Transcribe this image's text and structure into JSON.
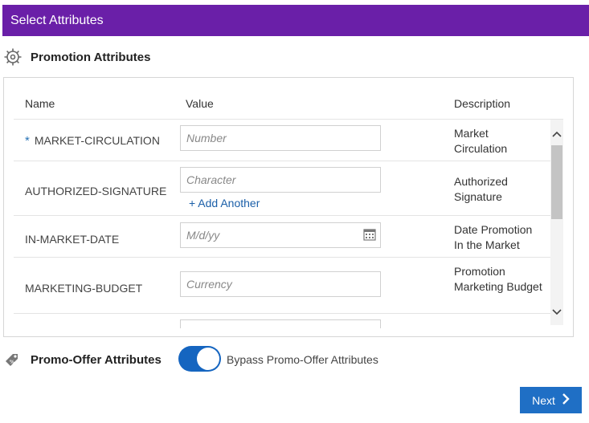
{
  "header": {
    "title": "Select Attributes"
  },
  "promotion_section": {
    "title": "Promotion Attributes",
    "icon": "gear-icon"
  },
  "table": {
    "columns": {
      "name": "Name",
      "value": "Value",
      "description": "Description"
    },
    "rows": [
      {
        "name": "MARKET-CIRCULATION",
        "required": "*",
        "placeholder": "Number",
        "description": "Market Circulation"
      },
      {
        "name": "AUTHORIZED-SIGNATURE",
        "placeholder": "Character",
        "add_label": "+ Add Another",
        "description": "Authorized Signature"
      },
      {
        "name": "IN-MARKET-DATE",
        "placeholder": "M/d/yy",
        "description": "Date Promotion In the Market"
      },
      {
        "name": "MARKETING-BUDGET",
        "placeholder": "Currency",
        "description": "Promotion Marketing Budget"
      }
    ]
  },
  "offer_section": {
    "title": "Promo-Offer Attributes",
    "icon": "tag-icon",
    "toggle_label": "Bypass Promo-Offer Attributes",
    "toggle_on": true
  },
  "footer": {
    "next_label": "Next"
  },
  "colors": {
    "header": "#6a1fa8",
    "accent": "#1f6fc5",
    "link": "#1b5fa8"
  }
}
